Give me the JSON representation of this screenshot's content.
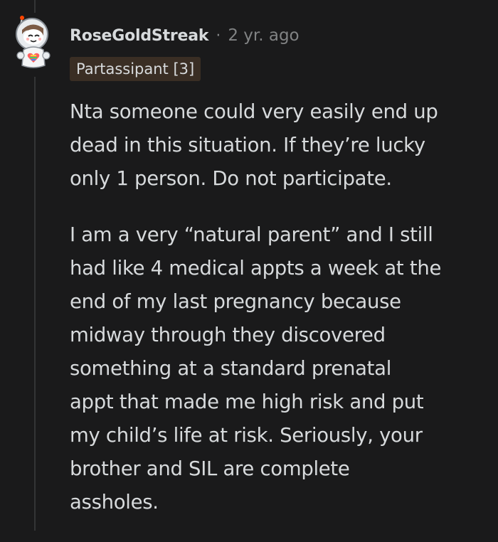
{
  "comment": {
    "username": "RoseGoldStreak",
    "separator": "·",
    "timestamp": "2 yr. ago",
    "flair": "Partassipant [3]",
    "paragraphs": [
      {
        "lines": [
          "Nta someone could very easily end up",
          "dead in this situation. If they’re lucky",
          "only 1 person. Do not participate."
        ]
      },
      {
        "lines": [
          "I am a very “natural parent” and I still",
          "had like 4 medical appts a week at the",
          "end of my last pregnancy because",
          "midway through they discovered",
          "something at a standard prenatal",
          "appt that made me high risk and put",
          "my child’s life at risk. Seriously, your",
          "brother and SIL are complete",
          "assholes."
        ]
      }
    ]
  },
  "colors": {
    "background": "#1a1a1b",
    "text": "#d7dadc",
    "meta": "#818384",
    "flair_bg": "#3a2e24",
    "thread_line": "#343536"
  },
  "icons": {
    "avatar": "snoo-astronaut-avatar-icon"
  }
}
